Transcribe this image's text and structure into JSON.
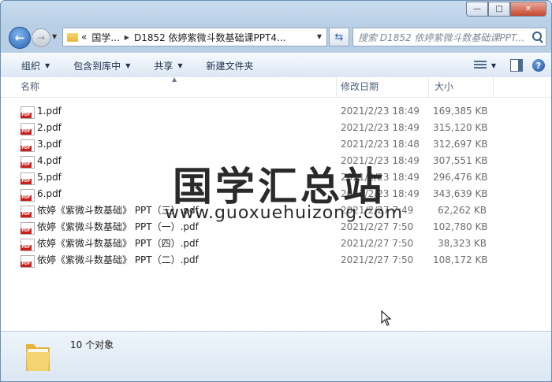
{
  "window": {
    "caption_min": "—",
    "caption_max": "□",
    "caption_close": "✕"
  },
  "nav": {
    "breadcrumb_overflow": "«",
    "breadcrumb_1": "国学...",
    "breadcrumb_2": "D1852 依婷紫微斗数基础课PPT4...",
    "search_placeholder": "搜索 D1852 依婷紫微斗数基础课PPT..."
  },
  "toolbar": {
    "organize": "组织",
    "include_library": "包含到库中",
    "share": "共享",
    "new_folder": "新建文件夹"
  },
  "columns": {
    "name": "名称",
    "modified": "修改日期",
    "size": "大小"
  },
  "files": [
    {
      "name": "1.pdf",
      "date": "2021/2/23 18:49",
      "size": "169,385 KB"
    },
    {
      "name": "2.pdf",
      "date": "2021/2/23 18:49",
      "size": "315,120 KB"
    },
    {
      "name": "3.pdf",
      "date": "2021/2/23 18:48",
      "size": "312,697 KB"
    },
    {
      "name": "4.pdf",
      "date": "2021/2/23 18:49",
      "size": "307,551 KB"
    },
    {
      "name": "5.pdf",
      "date": "2021/2/23 18:49",
      "size": "296,476 KB"
    },
    {
      "name": "6.pdf",
      "date": "2021/2/23 18:49",
      "size": "343,639 KB"
    },
    {
      "name": "依婷《紫微斗数基础》 PPT（三）.pdf",
      "date": "2021/2/27 7:49",
      "size": "62,262 KB"
    },
    {
      "name": "依婷《紫微斗数基础》 PPT（一）.pdf",
      "date": "2021/2/27 7:50",
      "size": "102,780 KB"
    },
    {
      "name": "依婷《紫微斗数基础》 PPT（四）.pdf",
      "date": "2021/2/27 7:50",
      "size": "38,323 KB"
    },
    {
      "name": "依婷《紫微斗数基础》 PPT（二）.pdf",
      "date": "2021/2/27 7:50",
      "size": "108,172 KB"
    }
  ],
  "watermark": {
    "title": "国学汇总站",
    "url": "www.guoxuehuizong.com"
  },
  "status": {
    "count": "10 个对象"
  }
}
